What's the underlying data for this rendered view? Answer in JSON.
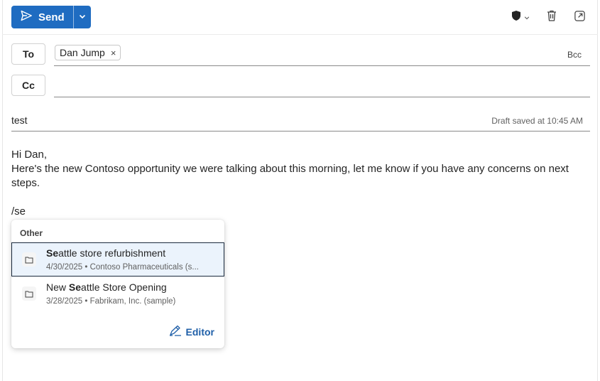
{
  "toolbar": {
    "send_label": "Send",
    "icons": [
      "send-icon",
      "chevron-down-icon",
      "shield-icon",
      "trash-icon",
      "pop-out-icon"
    ]
  },
  "to": {
    "button_label": "To",
    "recipients": [
      {
        "name": "Dan Jump",
        "remove": "×"
      }
    ],
    "bcc_label": "Bcc"
  },
  "cc": {
    "button_label": "Cc"
  },
  "subject": {
    "value": "test",
    "draft_status": "Draft saved at 10:45 AM"
  },
  "body": {
    "greeting": "Hi Dan,",
    "line": "Here's the new Contoso opportunity we were talking about this morning, let me know if you have any concerns on next steps.",
    "command": "/se"
  },
  "suggestions": {
    "header": "Other",
    "items": [
      {
        "title_match": "Se",
        "title_rest": "attle store refurbishment",
        "subtitle": "4/30/2025 • Contoso Pharmaceuticals (s...",
        "selected": true
      },
      {
        "title_prefix": "New ",
        "title_match": "Se",
        "title_rest": "attle Store Opening",
        "subtitle": "3/28/2025 • Fabrikam, Inc. (sample)",
        "selected": false
      }
    ],
    "footer_label": "Editor"
  },
  "colors": {
    "accent": "#1f6cc1",
    "selected_bg": "#ebf3fc",
    "editor": "#1f5fa8"
  }
}
